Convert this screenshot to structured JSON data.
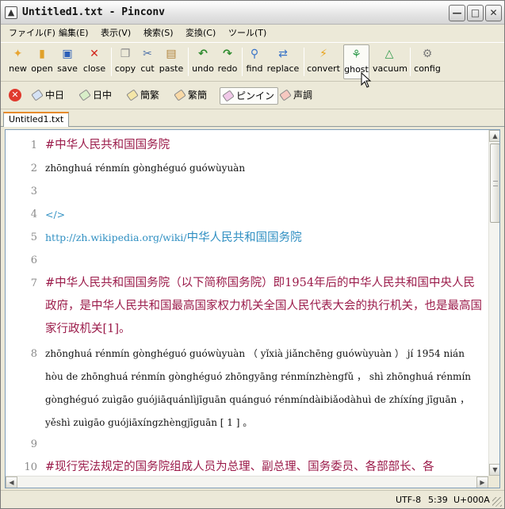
{
  "window": {
    "title": "Untitled1.txt - Pinconv"
  },
  "menu": [
    "ファイル(F)",
    "編集(E)",
    "表示(V)",
    "検索(S)",
    "変換(C)",
    "ツール(T)"
  ],
  "toolbar": {
    "new": "new",
    "open": "open",
    "save": "save",
    "close": "close",
    "copy": "copy",
    "cut": "cut",
    "paste": "paste",
    "undo": "undo",
    "redo": "redo",
    "find": "find",
    "replace": "replace",
    "convert": "convert",
    "ghost": "ghost",
    "vacuum": "vacuum",
    "config": "config"
  },
  "modes": [
    "中日",
    "日中",
    "簡繁",
    "繁簡",
    "ピンイン",
    "声調"
  ],
  "active_mode": "ピンイン",
  "tab": {
    "label": "Untitled1.txt"
  },
  "editor": {
    "line1": "#中华人民共和国国务院",
    "line2": "zhōnghuá rénmín gònghéguó guówùyuàn",
    "line4": "</>",
    "line5_url": "http://zh.wikipedia.org/wiki/",
    "line5_text": "中华人民共和国国务院",
    "line7": "#中华人民共和国国务院（以下简称国务院）即1954年后的中华人民共和国中央人民政府，是中华人民共和国最高国家权力机关全国人民代表大会的执行机关，也是最高国家行政机关[1]。",
    "line8": "zhōnghuá rénmín gònghéguó guówùyuàn （ yǐxià jiǎnchēng guówùyuàn ） jí 1954 nián hòu de zhōnghuá rénmín gònghéguó zhōngyāng rénmínzhèngfǔ ， shì zhōnghuá rénmín gònghéguó zuìgāo guójiāquánlìjīguān quánguó rénmíndàibiǎodàhuì de zhíxíng jīguān ， yěshì zuìgāo guójiāxíngzhèngjīguān [ 1 ] 。",
    "line10": "#现行宪法规定的国务院组成人员为总理、副总理、国务委员、各部部长、各",
    "line_numbers": [
      "1",
      "2",
      "3",
      "4",
      "5",
      "6",
      "7",
      "8",
      "9",
      "10"
    ]
  },
  "status": {
    "encoding": "UTF-8",
    "position": "5:39",
    "codepoint": "U+000A"
  },
  "colors": {
    "cjk_text": "#9b1b4a",
    "link": "#2f8fc2",
    "tab_accent": "#e68b2c"
  }
}
